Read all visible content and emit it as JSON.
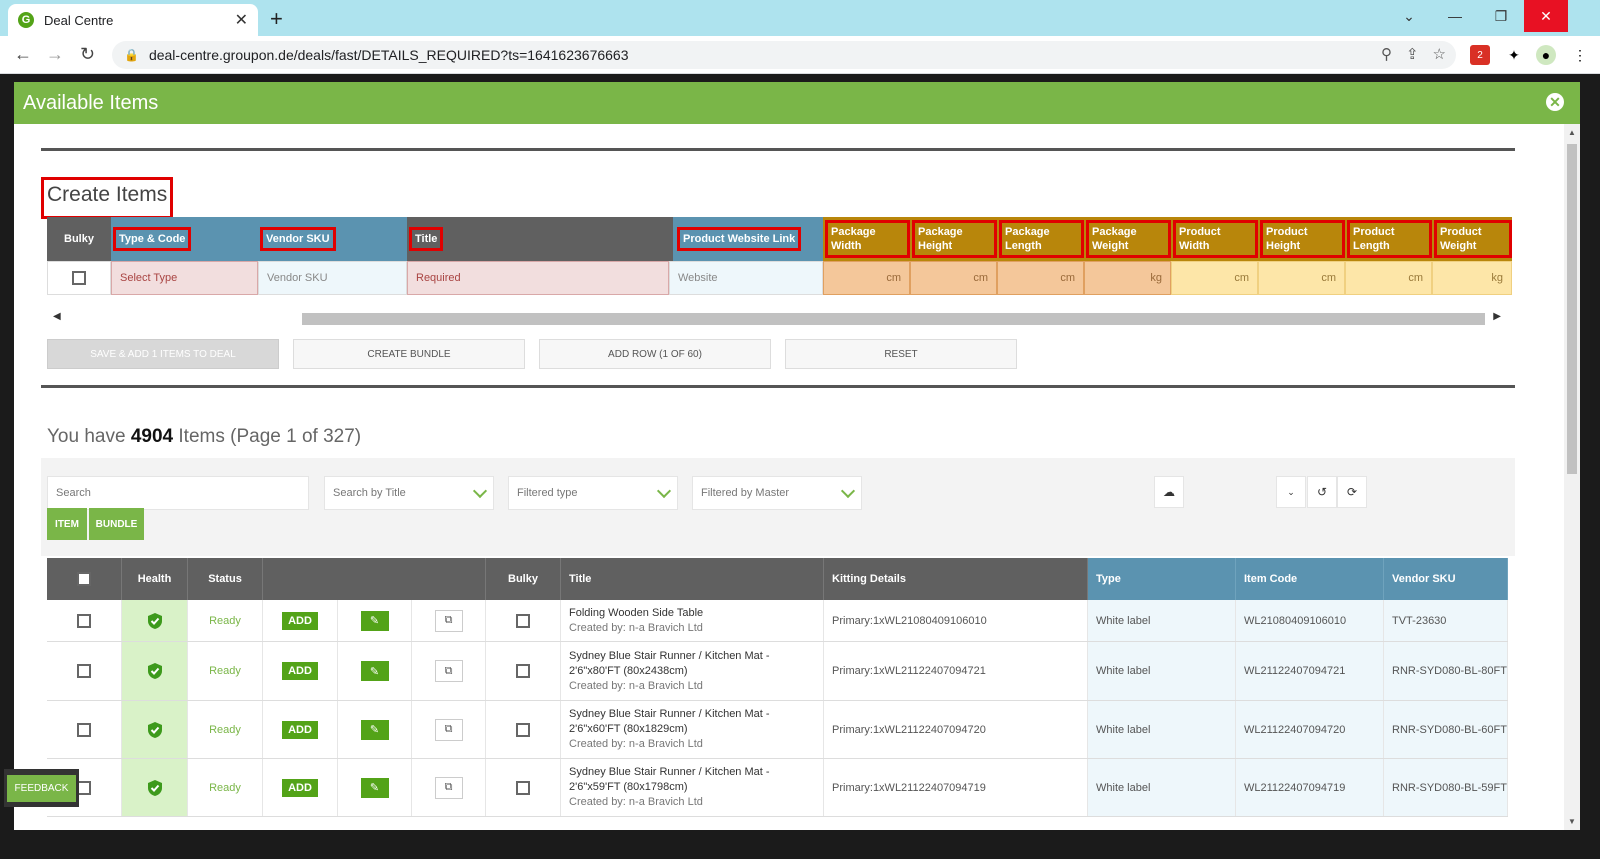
{
  "browser": {
    "tab_title": "Deal Centre",
    "url": "deal-centre.groupon.de/deals/fast/DETAILS_REQUIRED?ts=1641623676663",
    "favicon_letter": "G",
    "ext_badge": "2"
  },
  "modal": {
    "title": "Available Items",
    "create_title": "Create Items",
    "grid_headers": [
      "Bulky",
      "Type & Code",
      "Vendor SKU",
      "Title",
      "Product Website Link",
      "Package Width",
      "Package Height",
      "Package Length",
      "Package Weight",
      "Product Width",
      "Product Height",
      "Product Length",
      "Product Weight"
    ],
    "grid_placeholders": {
      "type": "Select Type",
      "sku": "Vendor SKU",
      "title": "Required",
      "website": "Website",
      "units": [
        "cm",
        "cm",
        "cm",
        "kg",
        "cm",
        "cm",
        "cm",
        "kg"
      ]
    },
    "buttons": {
      "save": "SAVE & ADD 1 ITEMS TO DEAL",
      "bundle": "CREATE BUNDLE",
      "addrow": "ADD ROW (1 OF 60)",
      "reset": "RESET"
    },
    "count": {
      "prefix": "You have",
      "number": "4904",
      "suffix": "Items (Page 1 of 327)"
    },
    "filters": {
      "search_placeholder": "Search",
      "search_by": "Search by Title",
      "type": "Filtered type",
      "master": "Filtered by Master",
      "item_btn": "ITEM",
      "bundle_btn": "BUNDLE"
    },
    "table": {
      "headers": [
        "",
        "Health",
        "Status",
        "",
        "Bulky",
        "Title",
        "Kitting Details",
        "Type",
        "Item Code",
        "Vendor SKU"
      ],
      "add_label": "ADD",
      "rows": [
        {
          "status": "Ready",
          "title": "Folding Wooden Side Table",
          "created": "Created by: n-a Bravich Ltd",
          "kitting": "Primary:1xWL21080409106010",
          "type": "White label",
          "code": "WL21080409106010",
          "sku": "TVT-23630"
        },
        {
          "status": "Ready",
          "title": "Sydney Blue Stair Runner / Kitchen Mat - 2'6\"x80'FT (80x2438cm)",
          "created": "Created by: n-a Bravich Ltd",
          "kitting": "Primary:1xWL21122407094721",
          "type": "White label",
          "code": "WL21122407094721",
          "sku": "RNR-SYD080-BL-80FT"
        },
        {
          "status": "Ready",
          "title": "Sydney Blue Stair Runner / Kitchen Mat - 2'6\"x60'FT (80x1829cm)",
          "created": "Created by: n-a Bravich Ltd",
          "kitting": "Primary:1xWL21122407094720",
          "type": "White label",
          "code": "WL21122407094720",
          "sku": "RNR-SYD080-BL-60FT"
        },
        {
          "status": "Ready",
          "title": "Sydney Blue Stair Runner / Kitchen Mat - 2'6\"x59'FT (80x1798cm)",
          "created": "Created by: n-a Bravich Ltd",
          "kitting": "Primary:1xWL21122407094719",
          "type": "White label",
          "code": "WL21122407094719",
          "sku": "RNR-SYD080-BL-59FT"
        }
      ]
    },
    "feedback": "FEEDBACK"
  },
  "colors": {
    "accent_green": "#7ab648",
    "header_blue": "#5b93b0",
    "header_gold": "#b8860b",
    "highlight_red": "#e00000"
  }
}
